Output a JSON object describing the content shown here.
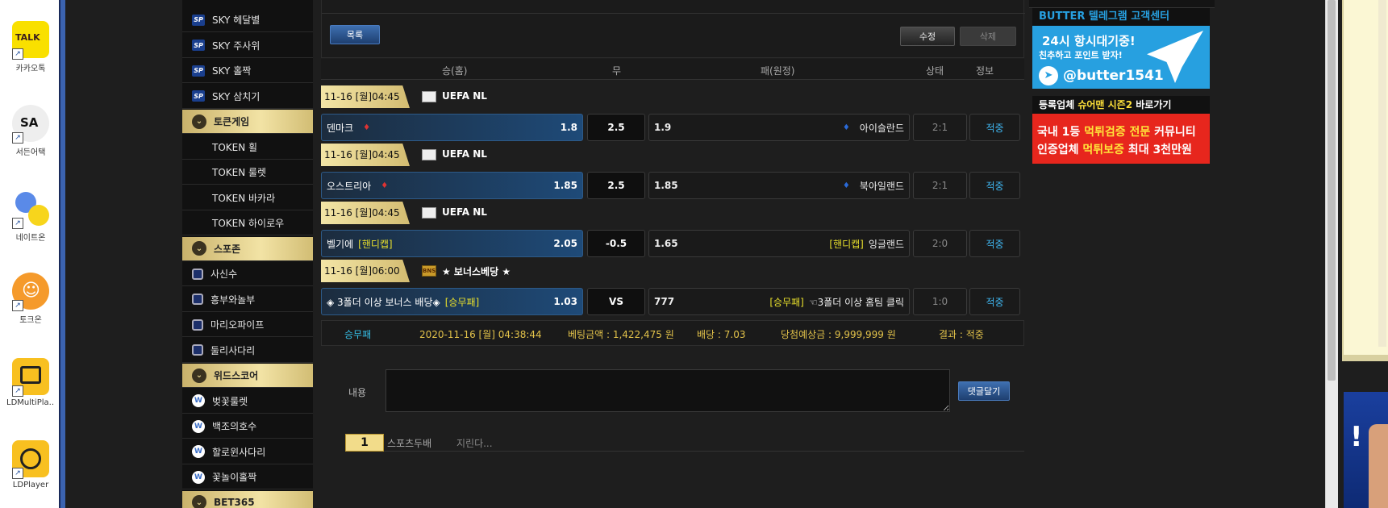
{
  "desktop": {
    "icons": [
      {
        "label": "카카오톡",
        "badge": "TALK"
      },
      {
        "label": "서든어택",
        "badge": "SA"
      },
      {
        "label": "네이트온",
        "badge": ""
      },
      {
        "label": "토크온",
        "badge": ""
      },
      {
        "label": "LDMultiPla...",
        "badge": ""
      },
      {
        "label": "LDPlayer",
        "badge": ""
      }
    ]
  },
  "sidebar": {
    "items": [
      {
        "label": "SKY 헤달별",
        "type": "sp"
      },
      {
        "label": "SKY 주사위",
        "type": "sp"
      },
      {
        "label": "SKY 홀짝",
        "type": "sp"
      },
      {
        "label": "SKY 삼치기",
        "type": "sp"
      },
      {
        "label": "토큰게임",
        "type": "section"
      },
      {
        "label": "TOKEN 휠",
        "type": "token"
      },
      {
        "label": "TOKEN 룰렛",
        "type": "token"
      },
      {
        "label": "TOKEN 바카라",
        "type": "token"
      },
      {
        "label": "TOKEN 하이로우",
        "type": "token"
      },
      {
        "label": "스포존",
        "type": "section"
      },
      {
        "label": "사신수",
        "type": "sq"
      },
      {
        "label": "흥부와놀부",
        "type": "sq"
      },
      {
        "label": "마리오파이프",
        "type": "sq"
      },
      {
        "label": "둘리사다리",
        "type": "sq"
      },
      {
        "label": "위드스코어",
        "type": "section"
      },
      {
        "label": "벚꽃룰렛",
        "type": "w"
      },
      {
        "label": "백조의호수",
        "type": "w"
      },
      {
        "label": "할로윈사다리",
        "type": "w"
      },
      {
        "label": "꽃놀이홀짝",
        "type": "w"
      },
      {
        "label": "BET365",
        "type": "section"
      }
    ],
    "sp_badge": "SP",
    "w_badge": "W"
  },
  "toolbar": {
    "list_label": "목록",
    "edit_label": "수정",
    "delete_label": "삭제"
  },
  "table": {
    "headers": {
      "home": "승(홈)",
      "draw": "무",
      "away": "패(원정)",
      "status": "상태",
      "info": "정보"
    }
  },
  "matches": [
    {
      "date": "11-16 [월]04:45",
      "league": "UEFA NL",
      "home": "덴마크",
      "home_tag": "",
      "home_odds": "1.8",
      "mid": "2.5",
      "away_odds": "1.9",
      "away_tag": "",
      "away": "아이슬란드",
      "score": "2:1",
      "result": "적중"
    },
    {
      "date": "11-16 [월]04:45",
      "league": "UEFA NL",
      "home": "오스트리아",
      "home_tag": "",
      "home_odds": "1.85",
      "mid": "2.5",
      "away_odds": "1.85",
      "away_tag": "",
      "away": "북아일랜드",
      "score": "2:1",
      "result": "적중"
    },
    {
      "date": "11-16 [월]04:45",
      "league": "UEFA NL",
      "home": "벨기에",
      "home_tag": "[핸디캡]",
      "home_odds": "2.05",
      "mid": "-0.5",
      "away_odds": "1.65",
      "away_tag": "[핸디캡]",
      "away": "잉글랜드",
      "score": "2:0",
      "result": "적중"
    },
    {
      "date": "11-16 [월]06:00",
      "league": "★ 보너스베당 ★",
      "home": "◈ 3폴더 이상 보너스 배당◈",
      "home_tag": "[승무패]",
      "home_odds": "1.03",
      "mid": "VS",
      "away_odds": "777",
      "away_tag": "[승무패]",
      "away": "☜3폴더 이상 홈팀 클릭",
      "score": "1:0",
      "result": "적중"
    }
  ],
  "bonus_flag_text": "BNS",
  "summary": {
    "type": "승무패",
    "datetime": "2020-11-16 [월] 04:38:44",
    "bet_amount": "베팅금액 : 1,422,475 원",
    "odds": "배당 : 7.03",
    "expected": "당첨예상금 : 9,999,999 원",
    "result": "결과 : 적중"
  },
  "comment": {
    "label": "내용",
    "button_label": "댓글달기",
    "rank": "1",
    "user": "스포츠두배",
    "text": "지린다..."
  },
  "ads": {
    "telegram": {
      "title": "BUTTER 텔레그램 고객센터",
      "line1": "24시 항시대기중!",
      "line2": "친추하고 포인트 받자!",
      "handle": "@butter1541"
    },
    "sureman": {
      "title_pre": "등록업체 ",
      "title_hl": "슈어맨 시즌2",
      "title_post": " 바로가기",
      "line1_a": "국내 1등 ",
      "line1_b": "먹튀검증 전문",
      "line1_c": " 커뮤니티",
      "line2_a": "인증업체 ",
      "line2_b": "먹튀보증",
      "line2_c": " 최대 3천만원"
    }
  },
  "colors": {
    "accent_gold": "#f2e3a5",
    "home_blue": "#1e4a78",
    "result_cyan": "#3fb6f0",
    "handicap_yellow": "#e8e02c",
    "telegram_blue": "#27a0e0",
    "ad_red": "#e7261d"
  }
}
